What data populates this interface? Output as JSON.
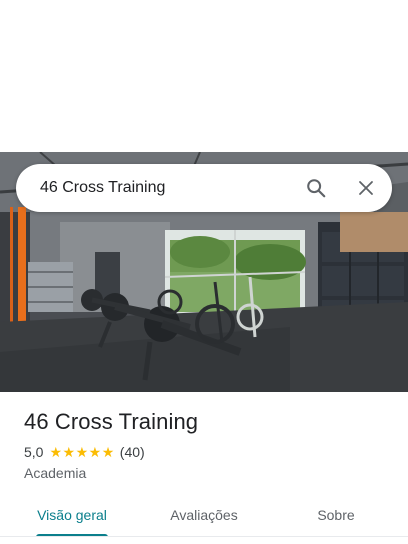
{
  "search": {
    "query": "46 Cross Training"
  },
  "place": {
    "name": "46 Cross Training",
    "rating": "5,0",
    "stars": 5,
    "review_count": "(40)",
    "category": "Academia"
  },
  "tabs": [
    {
      "label": "Visão geral",
      "active": true
    },
    {
      "label": "Avaliações",
      "active": false
    },
    {
      "label": "Sobre",
      "active": false
    }
  ],
  "colors": {
    "accent": "#0b7f8c",
    "star": "#fbbc04"
  },
  "icons": {
    "search": "search-icon",
    "close": "close-icon"
  }
}
